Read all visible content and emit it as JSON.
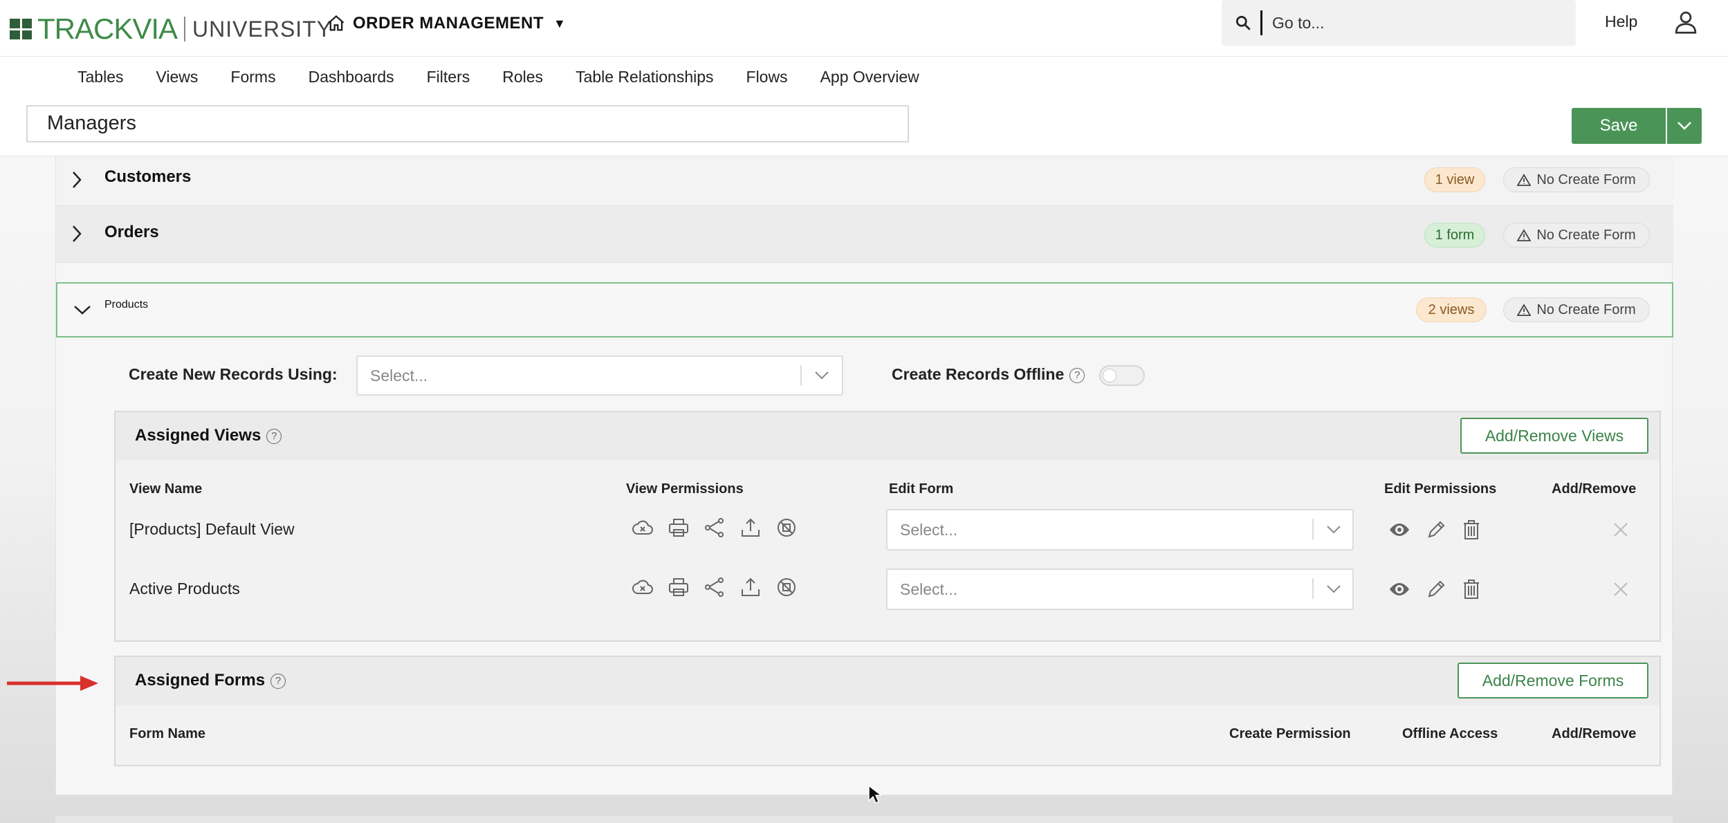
{
  "header": {
    "logo_brand": "TRACKVIA",
    "logo_sub": "UNIVERSITY",
    "app_name": "ORDER MANAGEMENT",
    "search_placeholder": "Go to...",
    "help_label": "Help"
  },
  "subnav": [
    "Tables",
    "Views",
    "Forms",
    "Dashboards",
    "Filters",
    "Roles",
    "Table Relationships",
    "Flows",
    "App Overview"
  ],
  "role_name": "Managers",
  "save_label": "Save",
  "tables": [
    {
      "name": "Customers",
      "badge": "1 view",
      "badge_color": "orange",
      "status": "No Create Form",
      "expanded": false
    },
    {
      "name": "Orders",
      "badge": "1 form",
      "badge_color": "green",
      "status": "No Create Form",
      "expanded": false
    },
    {
      "name": "Products",
      "badge": "2 views",
      "badge_color": "orange",
      "status": "No Create Form",
      "expanded": true
    }
  ],
  "products": {
    "create_new_label": "Create New Records Using:",
    "create_new_value": "Select...",
    "offline_label": "Create Records Offline",
    "offline_enabled": false,
    "assigned_views": {
      "title": "Assigned Views",
      "button": "Add/Remove Views",
      "columns": [
        "View Name",
        "View Permissions",
        "Edit Form",
        "Edit Permissions",
        "Add/Remove"
      ],
      "rows": [
        {
          "name": "[Products] Default View",
          "edit_form": "Select..."
        },
        {
          "name": "Active Products",
          "edit_form": "Select..."
        }
      ]
    },
    "assigned_forms": {
      "title": "Assigned Forms",
      "button": "Add/Remove Forms",
      "columns": [
        "Form Name",
        "Create Permission",
        "Offline Access",
        "Add/Remove"
      ]
    }
  },
  "colors": {
    "accent_green": "#4a9458",
    "arrow_red": "#d9302c"
  }
}
